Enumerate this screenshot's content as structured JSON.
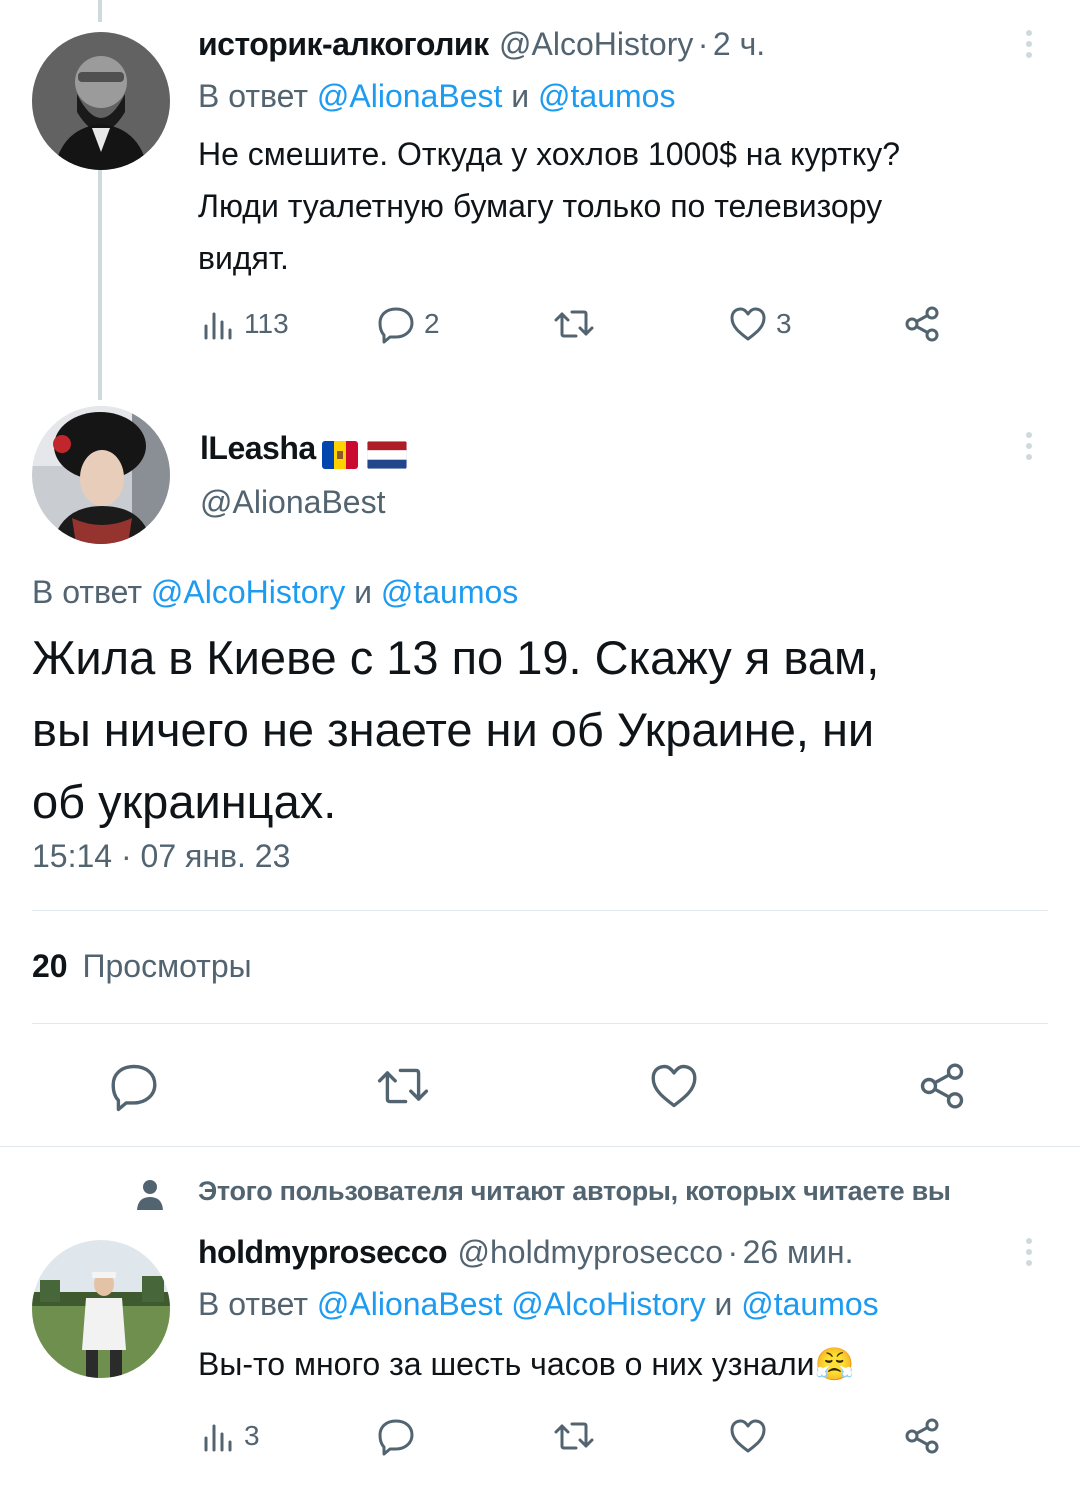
{
  "tweet1": {
    "display_name": "историк-алкоголик",
    "handle": "@AlcoHistory",
    "separator": "·",
    "time": "2 ч.",
    "reply_prefix": "В ответ",
    "reply_user1": "@AlionaBest",
    "reply_and": "и",
    "reply_user2": "@taumos",
    "text_line1": "Не смешите. Откуда у хохлов 1000$ на куртку?",
    "text_line2": "Люди туалетную бумагу только по телевизору",
    "text_line3": "видят.",
    "views": "113",
    "replies": "2",
    "likes": "3"
  },
  "tweet2": {
    "display_name": "lLeasha",
    "handle": "@AlionaBest",
    "reply_prefix": "В ответ",
    "reply_user1": "@AlcoHistory",
    "reply_and": "и",
    "reply_user2": "@taumos",
    "text_line1": "Жила в Киеве с 13 по 19. Скажу я вам,",
    "text_line2": "вы ничего не знаете ни об Украине, ни",
    "text_line3": "об украинцах.",
    "timestamp": "15:14 · 07 янв. 23",
    "views_count": "20",
    "views_label": "Просмотры"
  },
  "social_context": "Этого пользователя читают авторы, которых читаете вы",
  "tweet3": {
    "display_name": "holdmyprosecco",
    "handle": "@holdmyprosecco",
    "separator": "·",
    "time": "26 мин.",
    "reply_prefix": "В ответ",
    "reply_user1": "@AlionaBest",
    "reply_user2": "@AlcoHistory",
    "reply_and": "и",
    "reply_user3": "@taumos",
    "text": "Вы-то много за шесть часов о них узнали",
    "emoji": "😤",
    "views": "3"
  },
  "colors": {
    "link": "#1d9bf0",
    "secondary_text": "#536471",
    "icon_grey": "#536471",
    "divider": "#e1e8ed"
  },
  "icons": [
    "views-icon",
    "reply-icon",
    "retweet-icon",
    "like-icon",
    "share-icon",
    "more-icon",
    "person-icon"
  ]
}
